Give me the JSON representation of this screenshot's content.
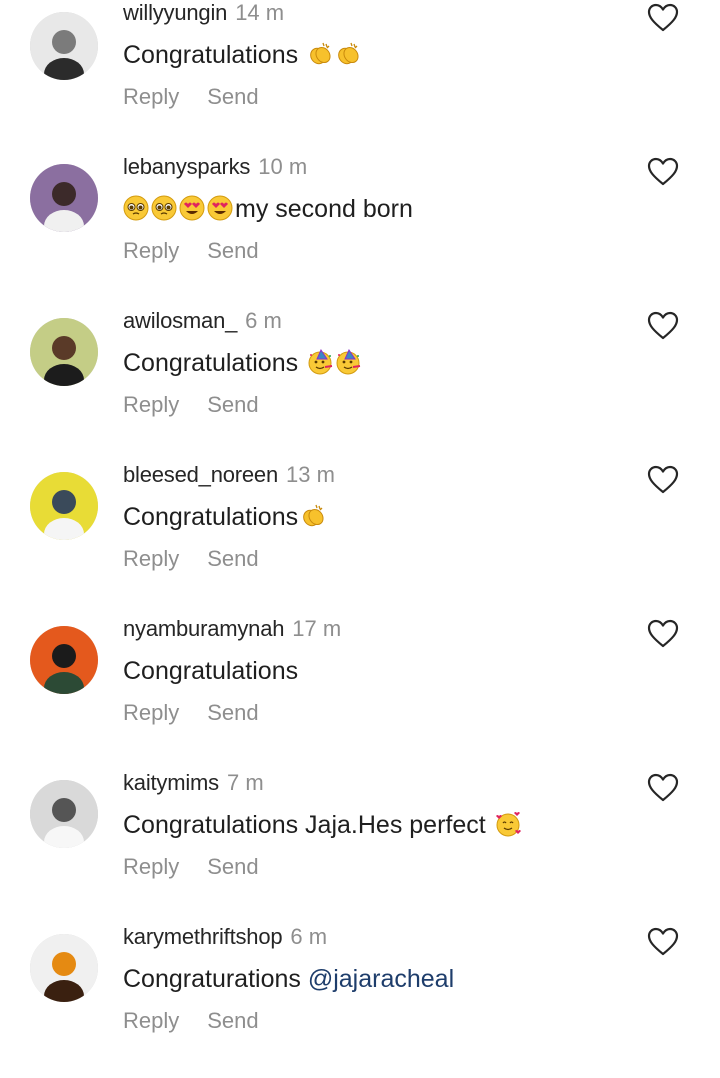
{
  "comments": [
    {
      "username": "willyyungin",
      "time": "14 m",
      "text": "Congratulations ",
      "emojis": [
        "clap-emoji",
        "clap-emoji"
      ],
      "mention": "",
      "avatar_bg": "#d9d9d9"
    },
    {
      "username": "lebanysparks",
      "time": "10 m",
      "text": "my second born",
      "emoji_prefix": [
        "pleading-face-emoji",
        "pleading-face-emoji",
        "heart-eyes-emoji",
        "heart-eyes-emoji"
      ],
      "emojis": [],
      "mention": "",
      "avatar_bg": "#7a5a8a"
    },
    {
      "username": "awilosman_",
      "time": "6 m",
      "text": "Congratulations ",
      "emojis": [
        "party-face-emoji",
        "party-face-emoji"
      ],
      "mention": "",
      "avatar_bg": "#b8c27a"
    },
    {
      "username": "bleesed_noreen",
      "time": "13 m",
      "text": "Congratulations",
      "emojis": [
        "clap-emoji"
      ],
      "mention": "",
      "avatar_bg": "#e2d63a"
    },
    {
      "username": "nyamburamynah",
      "time": "17 m",
      "text": "Congratulations",
      "emojis": [],
      "mention": "",
      "avatar_bg": "#e0531c"
    },
    {
      "username": "kaitymims",
      "time": "7 m",
      "text": "Congratulations Jaja.Hes perfect ",
      "emojis": [
        "smiling-hearts-emoji"
      ],
      "mention": "",
      "avatar_bg": "#d5d5d5"
    },
    {
      "username": "karymethriftshop",
      "time": "6 m",
      "text": "Congraturations ",
      "emojis": [],
      "mention": "@jajaracheal",
      "avatar_bg": "#e9e9e9"
    }
  ],
  "actions": {
    "reply": "Reply",
    "send": "Send"
  },
  "colors": {
    "username": "#262626",
    "meta": "#8e8e8e",
    "mention": "#1e3d6b"
  }
}
